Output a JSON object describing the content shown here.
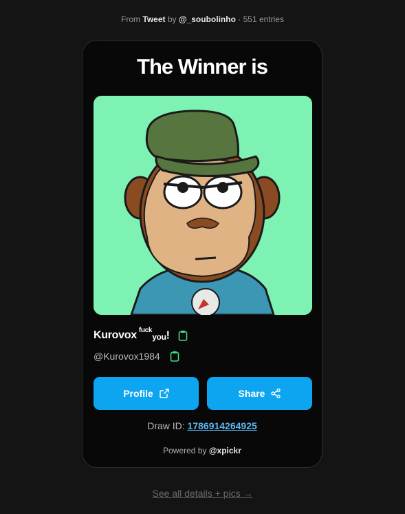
{
  "source": {
    "from_label": "From",
    "link_label": "Tweet",
    "by_label": "by",
    "author": "@_soubolinho",
    "separator": "·",
    "entries": "551 entries"
  },
  "card": {
    "title": "The Winner is",
    "winner": {
      "display_name": "Kurovox",
      "name_sup": "fuck",
      "name_sub": "you",
      "name_suffix": "!",
      "handle": "@Kurovox1984"
    },
    "buttons": {
      "profile_label": "Profile",
      "share_label": "Share"
    },
    "draw": {
      "label": "Draw ID:",
      "id": "1786914264925"
    },
    "powered": {
      "label": "Powered by",
      "brand": "@xpickr"
    }
  },
  "details_link": "See all details + pics →",
  "colors": {
    "background": "#141414",
    "card": "#080808",
    "accent": "#0ea5f0",
    "copy_icon": "#3ddc84",
    "avatar_bg": "#7df2b3"
  },
  "icons": [
    "copy-icon",
    "external-link-icon",
    "share-icon"
  ]
}
